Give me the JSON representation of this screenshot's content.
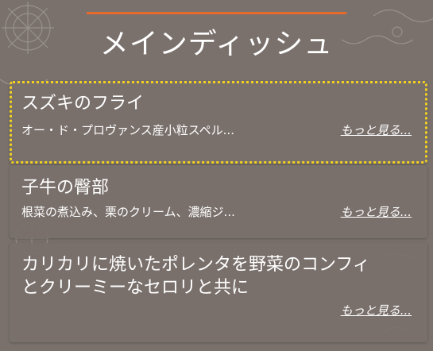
{
  "header": {
    "title": "メインディッシュ",
    "accent_color": "#e8692c"
  },
  "menu": {
    "items": [
      {
        "title": "スズキのフライ",
        "description": "オー・ド・プロヴァンス産小粒スペル...",
        "more_label": "もっと見る..."
      },
      {
        "title": "子牛の臀部",
        "description": "根菜の煮込み、栗のクリーム、濃縮ジ...",
        "more_label": "もっと見る..."
      },
      {
        "title": "カリカリに焼いたポレンタを野菜のコンフィとクリーミーなセロリと共に",
        "description": "",
        "more_label": "もっと見る..."
      }
    ],
    "focus_color": "#f2d21f"
  }
}
